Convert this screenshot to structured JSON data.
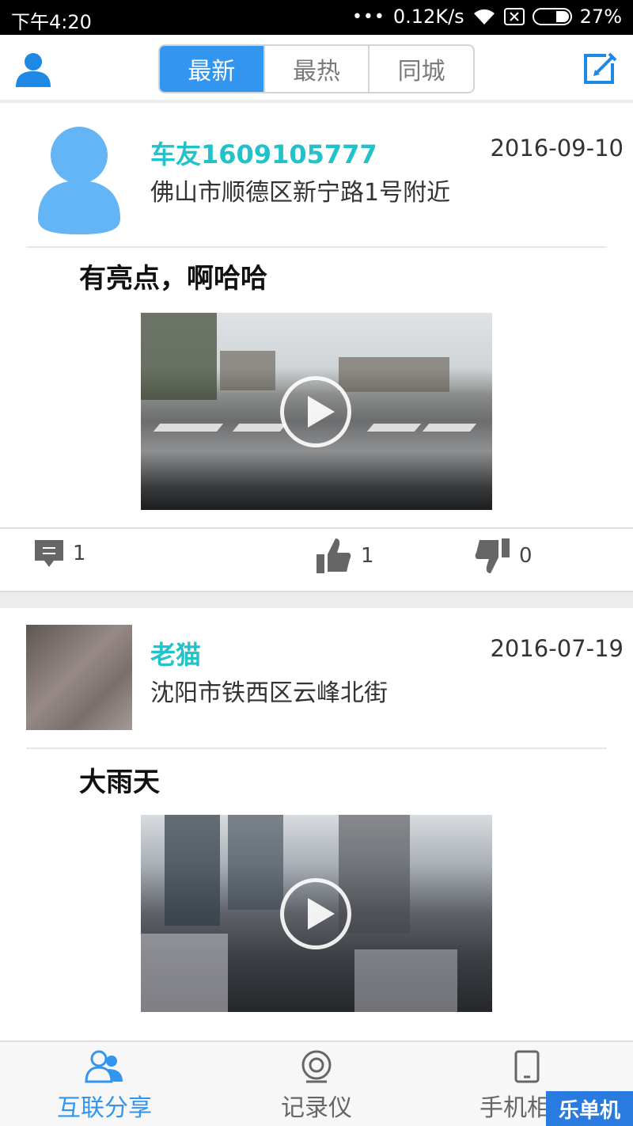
{
  "status_bar": {
    "time": "下午4:20",
    "network_speed": "0.12K/s",
    "battery": "27%",
    "battery_level": 0.27
  },
  "header": {
    "tabs": [
      {
        "label": "最新",
        "active": true
      },
      {
        "label": "最热",
        "active": false
      },
      {
        "label": "同城",
        "active": false
      }
    ],
    "left_icon": "user-icon",
    "right_icon": "edit-icon",
    "accent_color": "#3296f0"
  },
  "posts": [
    {
      "username": "车友1609105777",
      "location": "佛山市顺德区新宁路1号附近",
      "date": "2016-09-10",
      "text": "有亮点，啊哈哈",
      "avatar": "default-avatar-icon",
      "comments": "1",
      "likes": "1",
      "dislikes": "0"
    },
    {
      "username": "老猫",
      "location": "沈阳市铁西区云峰北街",
      "date": "2016-07-19",
      "text": "大雨天",
      "avatar": "photo-avatar"
    }
  ],
  "tabbar": {
    "items": [
      {
        "label": "互联分享",
        "icon": "people-icon",
        "active": true
      },
      {
        "label": "记录仪",
        "icon": "camera-icon",
        "active": false
      },
      {
        "label": "手机相册",
        "icon": "phone-icon",
        "active": false
      }
    ]
  },
  "watermark": "乐单机",
  "colors": {
    "username": "#21c2c9",
    "active_tab": "#3296f0"
  }
}
